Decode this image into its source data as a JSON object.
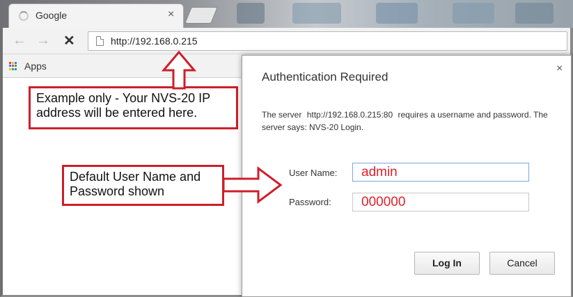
{
  "tab": {
    "title": "Google",
    "close": "×"
  },
  "toolbar": {
    "back": "←",
    "forward": "→",
    "stop": "✕",
    "url": "http://192.168.0.215"
  },
  "bookmarks": {
    "apps_label": "Apps",
    "apps_colors": [
      "#e8453c",
      "#f9bb2d",
      "#3a7ded",
      "#3a7ded",
      "#e8453c",
      "#33a752",
      "#f9bb2d",
      "#33a752",
      "#3a7ded"
    ]
  },
  "dialog": {
    "title": "Authentication Required",
    "close": "×",
    "message_part1": "The server",
    "message_server": "http://192.168.0.215:80",
    "message_part2": "requires a username and password. The server says: NVS-20 Login.",
    "username_label": "User Name:",
    "username_value": "admin",
    "password_label": "Password:",
    "password_value": "000000",
    "login_label": "Log In",
    "cancel_label": "Cancel"
  },
  "callouts": {
    "ip_note": "Example only - Your NVS-20 IP address will be entered here.",
    "default_note": "Default User Name and Password shown"
  },
  "colors": {
    "accent_red": "#cc1f2a",
    "input_text_red": "#e0202a"
  }
}
